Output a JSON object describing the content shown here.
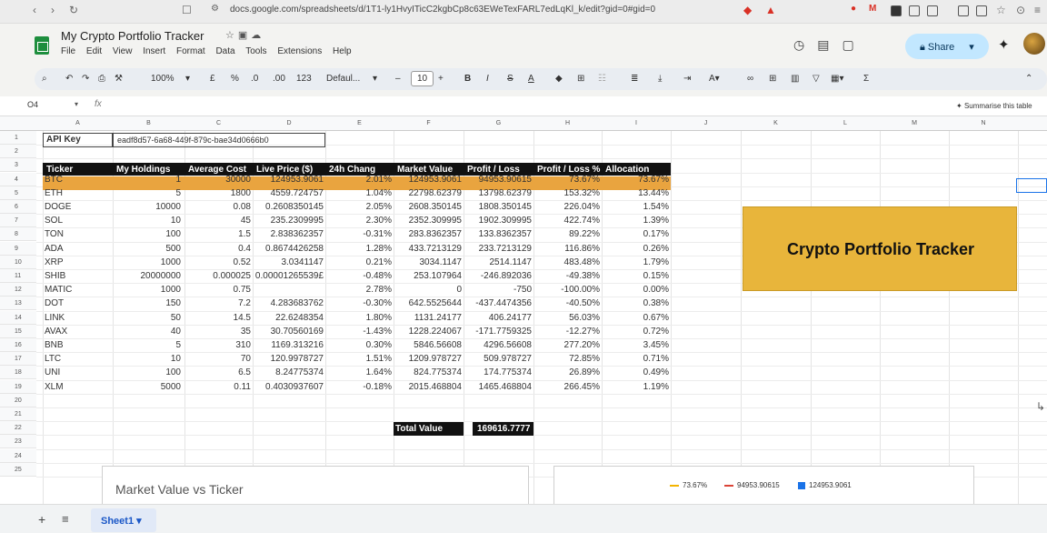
{
  "browser": {
    "url": "docs.google.com/spreadsheets/d/1T1-ly1HvyITicC2kgbCp8c63EWeTexFARL7edLqKl_k/edit?gid=0#gid=0"
  },
  "doc": {
    "title": "My Crypto Portfolio Tracker",
    "menu": [
      "File",
      "Edit",
      "View",
      "Insert",
      "Format",
      "Data",
      "Tools",
      "Extensions",
      "Help"
    ],
    "share_label": "Share"
  },
  "toolbar": {
    "zoom": "100%",
    "currency": "£",
    "percent": "%",
    "decimal_dec": ".0",
    "decimal_inc": ".00",
    "number_format": "123",
    "font": "Defaul...",
    "font_size": "10",
    "bold": "B",
    "italic": "I",
    "strike": "S",
    "text_color": "A"
  },
  "formula_bar": {
    "name_box": "O4",
    "fx": "fx",
    "summarise": "Summarise this table"
  },
  "columns": [
    "A",
    "B",
    "C",
    "D",
    "E",
    "F",
    "G",
    "H",
    "I",
    "J",
    "K",
    "L",
    "M",
    "N"
  ],
  "rows": [
    "1",
    "2",
    "3",
    "4",
    "5",
    "6",
    "7",
    "8",
    "9",
    "10",
    "11",
    "12",
    "13",
    "14",
    "15",
    "16",
    "17",
    "18",
    "19",
    "20",
    "21",
    "22",
    "23",
    "24",
    "25"
  ],
  "api": {
    "label": "API Key",
    "value": "eadf8d57-6a68-449f-879c-bae34d0666b0"
  },
  "table_headers": [
    "Ticker",
    "My Holdings",
    "Average Cost",
    "Live Price ($)",
    "24h Chang",
    "Market Value",
    "Profit / Loss",
    "Profit / Loss %",
    "Allocation"
  ],
  "table_rows": [
    [
      "BTC",
      "1",
      "30000",
      "124953.9061",
      "2.01%",
      "124953.9061",
      "94953.90615",
      "73.67%",
      "73.67%"
    ],
    [
      "ETH",
      "5",
      "1800",
      "4559.724757",
      "1.04%",
      "22798.62379",
      "13798.62379",
      "153.32%",
      "13.44%"
    ],
    [
      "DOGE",
      "10000",
      "0.08",
      "0.2608350145",
      "2.05%",
      "2608.350145",
      "1808.350145",
      "226.04%",
      "1.54%"
    ],
    [
      "SOL",
      "10",
      "45",
      "235.2309995",
      "2.30%",
      "2352.309995",
      "1902.309995",
      "422.74%",
      "1.39%"
    ],
    [
      "TON",
      "100",
      "1.5",
      "2.838362357",
      "-0.31%",
      "283.8362357",
      "133.8362357",
      "89.22%",
      "0.17%"
    ],
    [
      "ADA",
      "500",
      "0.4",
      "0.8674426258",
      "1.28%",
      "433.7213129",
      "233.7213129",
      "116.86%",
      "0.26%"
    ],
    [
      "XRP",
      "1000",
      "0.52",
      "3.0341147",
      "0.21%",
      "3034.1147",
      "2514.1147",
      "483.48%",
      "1.79%"
    ],
    [
      "SHIB",
      "20000000",
      "0.000025",
      "0.00001265539£",
      "-0.48%",
      "253.107964",
      "-246.892036",
      "-49.38%",
      "0.15%"
    ],
    [
      "MATIC",
      "1000",
      "0.75",
      "",
      "2.78%",
      "0",
      "-750",
      "-100.00%",
      "0.00%"
    ],
    [
      "DOT",
      "150",
      "7.2",
      "4.283683762",
      "-0.30%",
      "642.5525644",
      "-437.4474356",
      "-40.50%",
      "0.38%"
    ],
    [
      "LINK",
      "50",
      "14.5",
      "22.6248354",
      "1.80%",
      "1131.24177",
      "406.24177",
      "56.03%",
      "0.67%"
    ],
    [
      "AVAX",
      "40",
      "35",
      "30.70560169",
      "-1.43%",
      "1228.224067",
      "-171.7759325",
      "-12.27%",
      "0.72%"
    ],
    [
      "BNB",
      "5",
      "310",
      "1169.313216",
      "0.30%",
      "5846.56608",
      "4296.56608",
      "277.20%",
      "3.45%"
    ],
    [
      "LTC",
      "10",
      "70",
      "120.9978727",
      "1.51%",
      "1209.978727",
      "509.978727",
      "72.85%",
      "0.71%"
    ],
    [
      "UNI",
      "100",
      "6.5",
      "8.24775374",
      "1.64%",
      "824.775374",
      "174.775374",
      "26.89%",
      "0.49%"
    ],
    [
      "XLM",
      "5000",
      "0.11",
      "0.4030937607",
      "-0.18%",
      "2015.468804",
      "1465.468804",
      "266.45%",
      "1.19%"
    ]
  ],
  "total": {
    "label": "Total Value",
    "value": "169616.7777"
  },
  "tracker_title": "Crypto Portfolio Tracker",
  "chart1_title": "Market Value vs Ticker",
  "chart2_legend": [
    {
      "label": "73.67%",
      "color": "#f4b400",
      "kind": "dash"
    },
    {
      "label": "94953.90615",
      "color": "#db4437",
      "kind": "dash"
    },
    {
      "label": "124953.9061",
      "color": "#1a73e8",
      "kind": "square"
    }
  ],
  "sheet_tab": "Sheet1"
}
